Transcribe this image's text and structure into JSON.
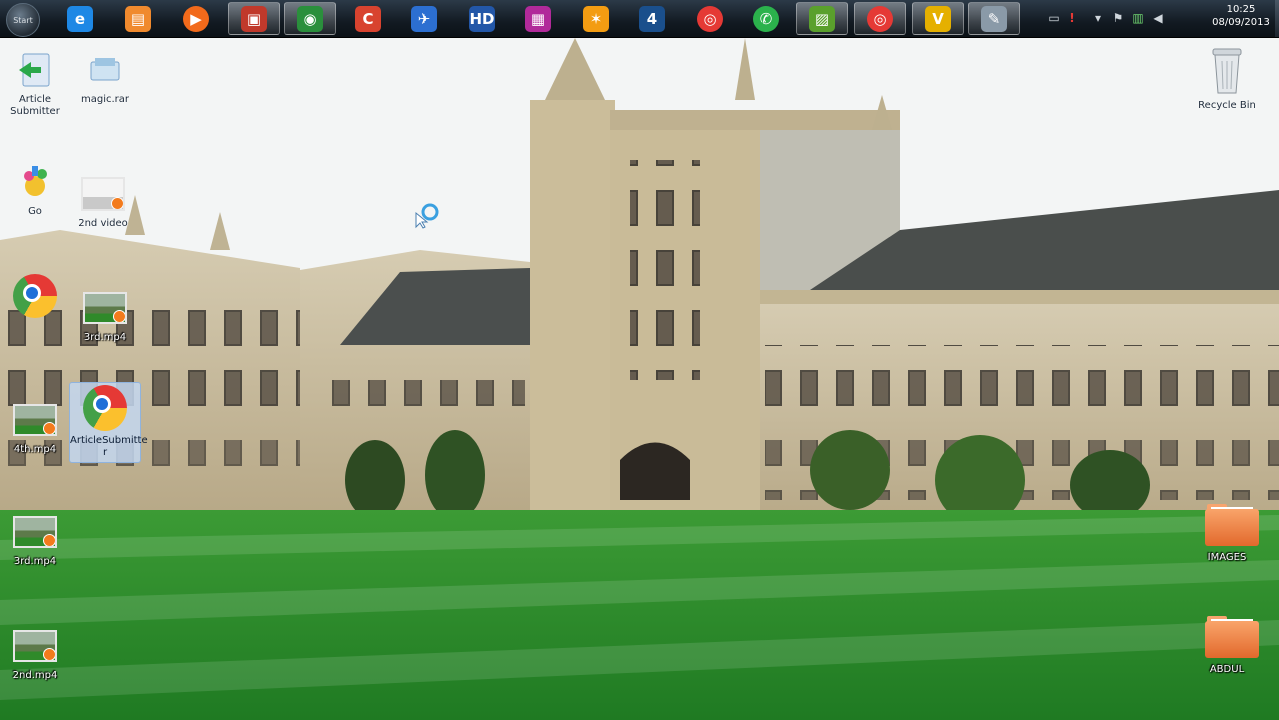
{
  "taskbar": {
    "start_label": "Start",
    "pinned": [
      {
        "name": "internet-explorer-icon",
        "glyph": "e",
        "color": "#1e88e5",
        "active": false
      },
      {
        "name": "folder-shortcut-icon",
        "glyph": "▤",
        "color": "#f08a2e",
        "active": false
      },
      {
        "name": "media-player-icon",
        "glyph": "▶",
        "color": "#f26a1b",
        "active": false
      },
      {
        "name": "screen-recorder-icon",
        "glyph": "▣",
        "color": "#c0392b",
        "active": true
      },
      {
        "name": "camera-app-icon",
        "glyph": "◉",
        "color": "#2a8f3c",
        "active": true
      },
      {
        "name": "ccleaner-icon",
        "glyph": "C",
        "color": "#d8432f",
        "active": false
      },
      {
        "name": "download-manager-icon",
        "glyph": "✈",
        "color": "#2c6fd1",
        "active": false
      },
      {
        "name": "hd-video-app-icon",
        "glyph": "HD",
        "color": "#2357a8",
        "active": false
      },
      {
        "name": "video-editor-icon",
        "glyph": "▦",
        "color": "#b12a9a",
        "active": false
      },
      {
        "name": "avast-icon",
        "glyph": "✶",
        "color": "#f39c12",
        "active": false
      },
      {
        "name": "number-four-app-icon",
        "glyph": "4",
        "color": "#1a4f8c",
        "active": false
      },
      {
        "name": "chrome-icon",
        "glyph": "◎",
        "color": "#e53935",
        "active": false
      },
      {
        "name": "whatsapp-icon",
        "glyph": "✆",
        "color": "#2bb24c",
        "active": false
      },
      {
        "name": "image-viewer-icon",
        "glyph": "▨",
        "color": "#5aa02c",
        "active": true
      },
      {
        "name": "chrome-window-icon",
        "glyph": "◎",
        "color": "#e53935",
        "active": true
      },
      {
        "name": "vivaldi-icon",
        "glyph": "V",
        "color": "#e5b000",
        "active": true
      },
      {
        "name": "notepad-icon",
        "glyph": "✎",
        "color": "#8a9aa8",
        "active": true
      }
    ],
    "clock_time": "10:25",
    "clock_date": "08/09/2013"
  },
  "desktop": {
    "icons": [
      {
        "id": "article-submitter",
        "label": "Article\nSubmitter",
        "kind": "app"
      },
      {
        "id": "magic-rar",
        "label": "magic.rar",
        "kind": "archive"
      },
      {
        "id": "app-3",
        "label": "Go",
        "kind": "app2"
      },
      {
        "id": "2nd-video",
        "label": "2nd video",
        "kind": "video"
      },
      {
        "id": "chrome-shortcut",
        "label": "",
        "kind": "chrome"
      },
      {
        "id": "3rd-mp4",
        "label": "3rd.mp4",
        "kind": "video"
      },
      {
        "id": "chrome-selected",
        "label": "ArticleSubmitte\nr",
        "kind": "chrome"
      },
      {
        "id": "4th-mp4",
        "label": "4th.mp4",
        "kind": "video"
      },
      {
        "id": "3rd-mp4-b",
        "label": "3rd.mp4",
        "kind": "video"
      },
      {
        "id": "2nd-mp4",
        "label": "2nd.mp4",
        "kind": "video"
      },
      {
        "id": "recycle-bin",
        "label": "Recycle Bin",
        "kind": "recycle"
      },
      {
        "id": "images-folder",
        "label": "IMAGES",
        "kind": "folder"
      },
      {
        "id": "abdul-folder",
        "label": "ABDUL",
        "kind": "folder"
      }
    ]
  },
  "colors": {
    "grass": "#2f8f2c",
    "stone": "#cdbf9f",
    "roof": "#4b4f4e",
    "sky": "#f2f4f4"
  }
}
